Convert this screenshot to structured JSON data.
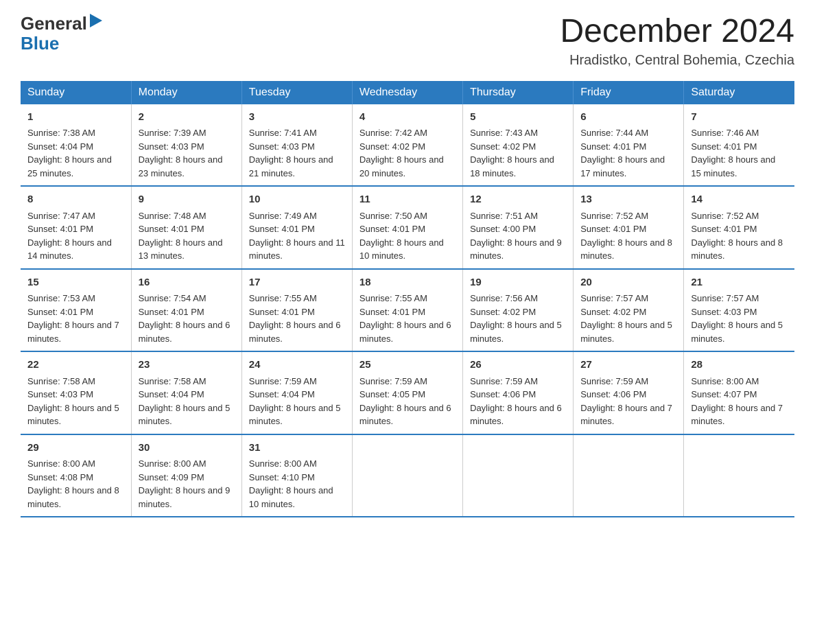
{
  "header": {
    "logo_general": "General",
    "logo_blue": "Blue",
    "month_title": "December 2024",
    "location": "Hradistko, Central Bohemia, Czechia"
  },
  "days_of_week": [
    "Sunday",
    "Monday",
    "Tuesday",
    "Wednesday",
    "Thursday",
    "Friday",
    "Saturday"
  ],
  "weeks": [
    [
      {
        "num": "1",
        "sunrise": "7:38 AM",
        "sunset": "4:04 PM",
        "daylight": "8 hours and 25 minutes."
      },
      {
        "num": "2",
        "sunrise": "7:39 AM",
        "sunset": "4:03 PM",
        "daylight": "8 hours and 23 minutes."
      },
      {
        "num": "3",
        "sunrise": "7:41 AM",
        "sunset": "4:03 PM",
        "daylight": "8 hours and 21 minutes."
      },
      {
        "num": "4",
        "sunrise": "7:42 AM",
        "sunset": "4:02 PM",
        "daylight": "8 hours and 20 minutes."
      },
      {
        "num": "5",
        "sunrise": "7:43 AM",
        "sunset": "4:02 PM",
        "daylight": "8 hours and 18 minutes."
      },
      {
        "num": "6",
        "sunrise": "7:44 AM",
        "sunset": "4:01 PM",
        "daylight": "8 hours and 17 minutes."
      },
      {
        "num": "7",
        "sunrise": "7:46 AM",
        "sunset": "4:01 PM",
        "daylight": "8 hours and 15 minutes."
      }
    ],
    [
      {
        "num": "8",
        "sunrise": "7:47 AM",
        "sunset": "4:01 PM",
        "daylight": "8 hours and 14 minutes."
      },
      {
        "num": "9",
        "sunrise": "7:48 AM",
        "sunset": "4:01 PM",
        "daylight": "8 hours and 13 minutes."
      },
      {
        "num": "10",
        "sunrise": "7:49 AM",
        "sunset": "4:01 PM",
        "daylight": "8 hours and 11 minutes."
      },
      {
        "num": "11",
        "sunrise": "7:50 AM",
        "sunset": "4:01 PM",
        "daylight": "8 hours and 10 minutes."
      },
      {
        "num": "12",
        "sunrise": "7:51 AM",
        "sunset": "4:00 PM",
        "daylight": "8 hours and 9 minutes."
      },
      {
        "num": "13",
        "sunrise": "7:52 AM",
        "sunset": "4:01 PM",
        "daylight": "8 hours and 8 minutes."
      },
      {
        "num": "14",
        "sunrise": "7:52 AM",
        "sunset": "4:01 PM",
        "daylight": "8 hours and 8 minutes."
      }
    ],
    [
      {
        "num": "15",
        "sunrise": "7:53 AM",
        "sunset": "4:01 PM",
        "daylight": "8 hours and 7 minutes."
      },
      {
        "num": "16",
        "sunrise": "7:54 AM",
        "sunset": "4:01 PM",
        "daylight": "8 hours and 6 minutes."
      },
      {
        "num": "17",
        "sunrise": "7:55 AM",
        "sunset": "4:01 PM",
        "daylight": "8 hours and 6 minutes."
      },
      {
        "num": "18",
        "sunrise": "7:55 AM",
        "sunset": "4:01 PM",
        "daylight": "8 hours and 6 minutes."
      },
      {
        "num": "19",
        "sunrise": "7:56 AM",
        "sunset": "4:02 PM",
        "daylight": "8 hours and 5 minutes."
      },
      {
        "num": "20",
        "sunrise": "7:57 AM",
        "sunset": "4:02 PM",
        "daylight": "8 hours and 5 minutes."
      },
      {
        "num": "21",
        "sunrise": "7:57 AM",
        "sunset": "4:03 PM",
        "daylight": "8 hours and 5 minutes."
      }
    ],
    [
      {
        "num": "22",
        "sunrise": "7:58 AM",
        "sunset": "4:03 PM",
        "daylight": "8 hours and 5 minutes."
      },
      {
        "num": "23",
        "sunrise": "7:58 AM",
        "sunset": "4:04 PM",
        "daylight": "8 hours and 5 minutes."
      },
      {
        "num": "24",
        "sunrise": "7:59 AM",
        "sunset": "4:04 PM",
        "daylight": "8 hours and 5 minutes."
      },
      {
        "num": "25",
        "sunrise": "7:59 AM",
        "sunset": "4:05 PM",
        "daylight": "8 hours and 6 minutes."
      },
      {
        "num": "26",
        "sunrise": "7:59 AM",
        "sunset": "4:06 PM",
        "daylight": "8 hours and 6 minutes."
      },
      {
        "num": "27",
        "sunrise": "7:59 AM",
        "sunset": "4:06 PM",
        "daylight": "8 hours and 7 minutes."
      },
      {
        "num": "28",
        "sunrise": "8:00 AM",
        "sunset": "4:07 PM",
        "daylight": "8 hours and 7 minutes."
      }
    ],
    [
      {
        "num": "29",
        "sunrise": "8:00 AM",
        "sunset": "4:08 PM",
        "daylight": "8 hours and 8 minutes."
      },
      {
        "num": "30",
        "sunrise": "8:00 AM",
        "sunset": "4:09 PM",
        "daylight": "8 hours and 9 minutes."
      },
      {
        "num": "31",
        "sunrise": "8:00 AM",
        "sunset": "4:10 PM",
        "daylight": "8 hours and 10 minutes."
      },
      null,
      null,
      null,
      null
    ]
  ]
}
